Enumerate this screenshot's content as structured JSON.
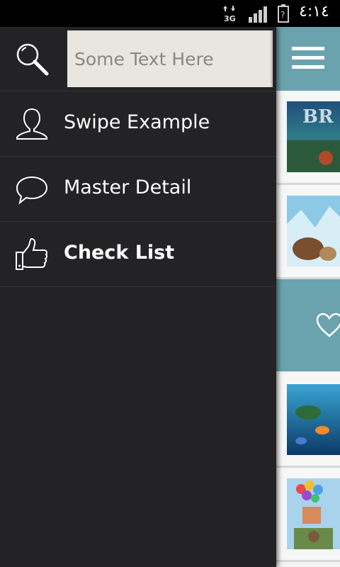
{
  "status_bar": {
    "time": "٤:١٤",
    "network": "3G",
    "signal_icon": "signal-bars-icon",
    "battery_icon": "battery-unknown-icon"
  },
  "drawer": {
    "search": {
      "icon": "search-icon",
      "placeholder": "Some Text Here"
    },
    "items": [
      {
        "label": "Swipe Example",
        "icon": "user-icon",
        "bold": false
      },
      {
        "label": "Master Detail",
        "icon": "speech-bubble-icon",
        "bold": false
      },
      {
        "label": "Check List",
        "icon": "thumbs-up-icon",
        "bold": true
      }
    ]
  },
  "content": {
    "toolbar_icon": "hamburger-menu-icon",
    "rows": [
      {
        "type": "image",
        "thumb": "brave-poster"
      },
      {
        "type": "image",
        "thumb": "ice-age-poster"
      },
      {
        "type": "highlight",
        "icon": "heart-icon"
      },
      {
        "type": "image",
        "thumb": "finding-nemo-poster"
      },
      {
        "type": "image",
        "thumb": "up-poster"
      }
    ]
  },
  "colors": {
    "drawer_bg": "#232224",
    "accent_teal": "#6aa3ae",
    "search_bg": "#e9e6e0"
  }
}
